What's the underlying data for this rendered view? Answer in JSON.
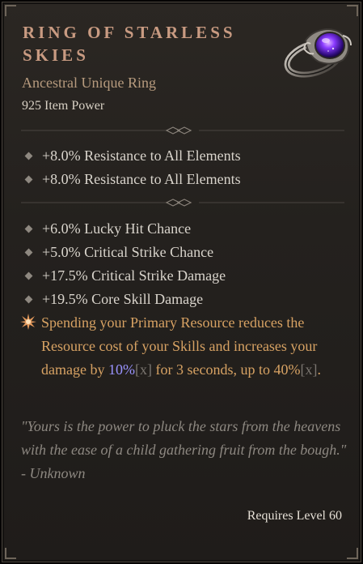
{
  "item": {
    "name": "Ring of Starless Skies",
    "type": "Ancestral Unique Ring",
    "power": "925 Item Power",
    "implicit_affixes": [
      "+8.0% Resistance to All Elements",
      "+8.0% Resistance to All Elements"
    ],
    "affixes": [
      "+6.0% Lucky Hit Chance",
      "+5.0% Critical Strike Chance",
      "+17.5% Critical Strike Damage",
      "+19.5% Core Skill Damage"
    ],
    "unique_power": {
      "part1": "Spending your Primary Resource reduces the Resource cost of your Skills and increases your damage by ",
      "value1": "10%",
      "bracket1": "[x]",
      "part2": " for 3 seconds, up to ",
      "value2": "40%",
      "bracket2": "[x]",
      "part3": "."
    },
    "flavor_text": "\"Yours is the power to pluck the stars from the heavens with the ease of a child gathering fruit from the bough.\"",
    "flavor_author": "- Unknown",
    "requires_level": "Requires Level 60"
  },
  "icons": {
    "item_icon": "ring-with-purple-gem-icon",
    "affix_bullet": "diamond-bullet-icon",
    "unique_bullet": "star-burst-icon"
  },
  "colors": {
    "title": "#c99b82",
    "item_type": "#b79b7e",
    "affix_text": "#d9d4cc",
    "unique_power": "#d7a263",
    "value_highlight": "#9a93ff",
    "flavor": "#8d8881"
  }
}
